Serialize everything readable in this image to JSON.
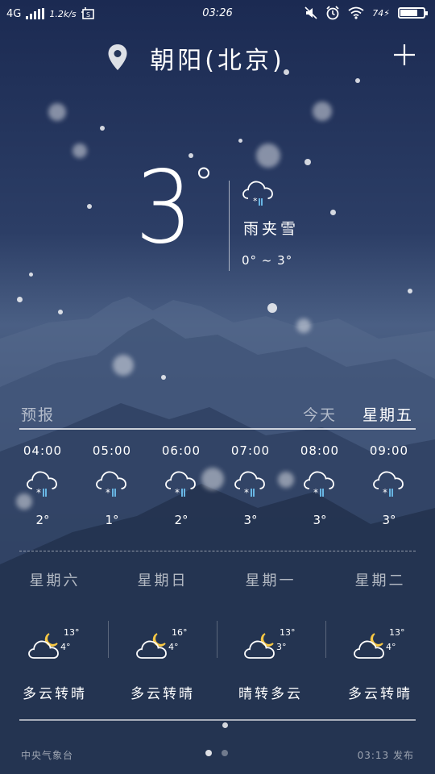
{
  "status_bar": {
    "network": "4G",
    "speed": "1.2k/s",
    "time": "03:26",
    "battery": "74"
  },
  "header": {
    "city": "朝阳(北京)"
  },
  "current": {
    "temperature": "3",
    "degree_symbol": "°",
    "description": "雨夹雪",
    "range": "0° ~ 3°",
    "icon": "cloud-sleet-icon"
  },
  "forecast": {
    "label": "预报",
    "today_label": "今天",
    "day_label": "星期五",
    "hours": [
      {
        "time": "04:00",
        "temp": "2°",
        "icon": "cloud-sleet-icon"
      },
      {
        "time": "05:00",
        "temp": "1°",
        "icon": "cloud-sleet-icon"
      },
      {
        "time": "06:00",
        "temp": "2°",
        "icon": "cloud-sleet-icon"
      },
      {
        "time": "07:00",
        "temp": "3°",
        "icon": "cloud-sleet-icon"
      },
      {
        "time": "08:00",
        "temp": "3°",
        "icon": "cloud-sleet-icon"
      },
      {
        "time": "09:00",
        "temp": "3°",
        "icon": "cloud-sleet-icon"
      }
    ]
  },
  "daily": [
    {
      "day": "星期六",
      "high": "13°",
      "low": "4°",
      "desc": "多云转晴",
      "icon": "cloud-moon-icon"
    },
    {
      "day": "星期日",
      "high": "16°",
      "low": "4°",
      "desc": "多云转晴",
      "icon": "cloud-moon-icon"
    },
    {
      "day": "星期一",
      "high": "13°",
      "low": "3°",
      "desc": "晴转多云",
      "icon": "cloud-moon-icon"
    },
    {
      "day": "星期二",
      "high": "13°",
      "low": "4°",
      "desc": "多云转晴",
      "icon": "cloud-moon-icon"
    }
  ],
  "footer": {
    "source": "中央气象台",
    "publish": "03:13 发布",
    "page_count": 2,
    "active_page": 1
  }
}
